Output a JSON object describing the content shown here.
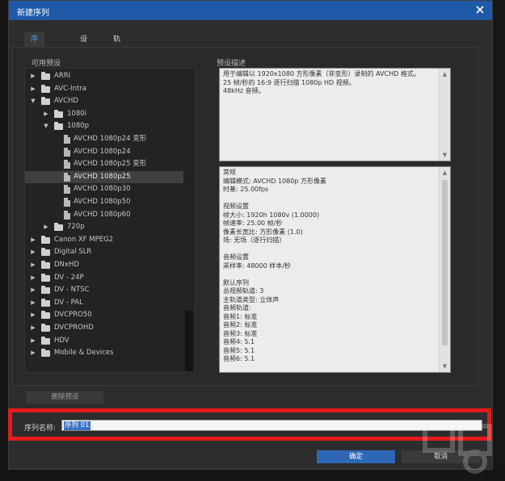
{
  "dialog": {
    "title": "新建序列",
    "tabs": [
      {
        "label": "序列预设",
        "active": true
      },
      {
        "label": "设置",
        "active": false
      },
      {
        "label": "轨道",
        "active": false
      }
    ]
  },
  "presets": {
    "label": "可用预设",
    "items": [
      {
        "label": "ARRI",
        "type": "folder",
        "expanded": false
      },
      {
        "label": "AVC-Intra",
        "type": "folder",
        "expanded": false
      },
      {
        "label": "AVCHD",
        "type": "folder",
        "expanded": true
      },
      {
        "label": "1080i",
        "type": "folder",
        "expanded": false
      },
      {
        "label": "1080p",
        "type": "folder",
        "expanded": true
      },
      {
        "label": "AVCHD 1080p24 变形",
        "type": "file"
      },
      {
        "label": "AVCHD 1080p24",
        "type": "file"
      },
      {
        "label": "AVCHD 1080p25 变形",
        "type": "file"
      },
      {
        "label": "AVCHD 1080p25",
        "type": "file",
        "selected": true
      },
      {
        "label": "AVCHD 1080p30",
        "type": "file"
      },
      {
        "label": "AVCHD 1080p50",
        "type": "file"
      },
      {
        "label": "AVCHD 1080p60",
        "type": "file"
      },
      {
        "label": "720p",
        "type": "folder",
        "expanded": false
      },
      {
        "label": "Canon XF MPEG2",
        "type": "folder",
        "expanded": false
      },
      {
        "label": "Digital SLR",
        "type": "folder",
        "expanded": false
      },
      {
        "label": "DNxHD",
        "type": "folder",
        "expanded": false
      },
      {
        "label": "DV - 24P",
        "type": "folder",
        "expanded": false
      },
      {
        "label": "DV - NTSC",
        "type": "folder",
        "expanded": false
      },
      {
        "label": "DV - PAL",
        "type": "folder",
        "expanded": false
      },
      {
        "label": "DVCPRO50",
        "type": "folder",
        "expanded": false
      },
      {
        "label": "DVCPROHD",
        "type": "folder",
        "expanded": false
      },
      {
        "label": "HDV",
        "type": "folder",
        "expanded": false
      },
      {
        "label": "Mobile & Devices",
        "type": "folder",
        "expanded": false
      }
    ],
    "delete_label": "删除预设"
  },
  "description": {
    "label": "预设描述",
    "text": "用于编辑以 1920x1080 方形像素（非变形）录制的 AVCHD 格式。\n25 帧/秒的 16:9 逐行扫描 1080p HD 视频。\n48kHz 音频。"
  },
  "details": {
    "text": "常规\n 编辑模式: AVCHD 1080p 方形像素\n 时基: 25.00fps\n\n视频设置\n 帧大小: 1920h 1080v (1.0000)\n 帧速率: 25.00 帧/秒\n 像素长宽比: 方形像素 (1.0)\n 场: 无场（逐行扫描）\n\n音频设置\n 采样率: 48000 样本/秒\n\n默认序列\n 总视频轨道: 3\n 主轨道类型: 立体声\n 音频轨道:\n 音频1: 标准\n 音频2: 标准\n 音频3: 标准\n 音频4: 5.1\n 音频5: 5.1\n 音频6: 5.1"
  },
  "sequence": {
    "name_label": "序列名称:",
    "name_value": "序列 01"
  },
  "buttons": {
    "ok": "确定",
    "cancel": "取消"
  },
  "colors": {
    "titlebar": "#1e5aa8",
    "highlight_border": "#e31b1b",
    "ok_button": "#2f67b7",
    "tab_active_text": "#4d9be6"
  }
}
